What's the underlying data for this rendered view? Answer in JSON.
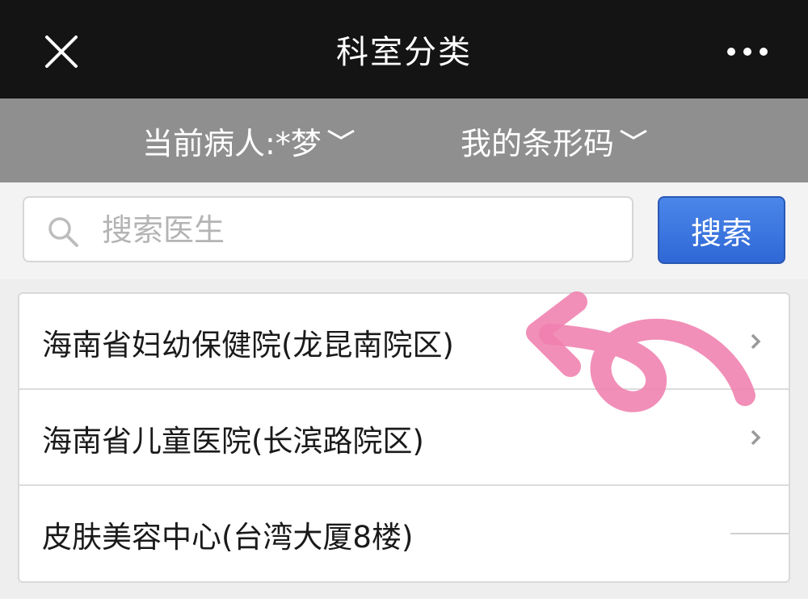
{
  "header": {
    "title": "科室分类",
    "close_icon": "close-icon",
    "more_icon": "more-icon"
  },
  "subbar": {
    "patient_label": "当前病人:*梦",
    "barcode_label": "我的条形码"
  },
  "search": {
    "placeholder": "搜索医生",
    "value": "",
    "button_label": "搜索"
  },
  "departments": [
    {
      "label": "海南省妇幼保健院(龙昆南院区)"
    },
    {
      "label": "海南省儿童医院(长滨路院区)"
    },
    {
      "label": "皮肤美容中心(台湾大厦8楼)"
    }
  ],
  "colors": {
    "topbar": "#141414",
    "subbar": "#8f8f8f",
    "button": "#2f68d6",
    "annotation": "#ef7fae"
  }
}
